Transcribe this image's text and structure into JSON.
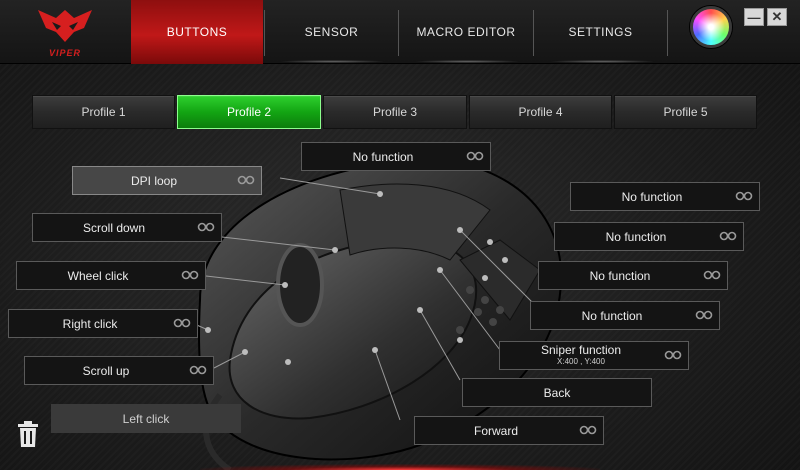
{
  "app": {
    "logo_text": "VIPER",
    "colors": {
      "accent_red": "#c01818",
      "active_green": "#13a513",
      "panel": "#141414"
    }
  },
  "nav": {
    "tabs": [
      {
        "label": "BUTTONS",
        "active": true
      },
      {
        "label": "SENSOR",
        "active": false
      },
      {
        "label": "MACRO EDITOR",
        "active": false
      },
      {
        "label": "SETTINGS",
        "active": false
      }
    ],
    "color_wheel_icon": "rgb-color-wheel-icon",
    "minimize_icon": "minimize-icon",
    "close_icon": "close-icon"
  },
  "profiles": [
    {
      "label": "Profile 1",
      "active": false
    },
    {
      "label": "Profile 2",
      "active": true
    },
    {
      "label": "Profile 3",
      "active": false
    },
    {
      "label": "Profile 4",
      "active": false
    },
    {
      "label": "Profile 5",
      "active": false
    }
  ],
  "buttons": {
    "top_center": {
      "label": "No function"
    },
    "dpi_loop": {
      "label": "DPI loop"
    },
    "scroll_down": {
      "label": "Scroll down"
    },
    "wheel_click": {
      "label": "Wheel click"
    },
    "right_click": {
      "label": "Right click"
    },
    "scroll_up": {
      "label": "Scroll up"
    },
    "left_click": {
      "label": "Left click"
    },
    "side_1": {
      "label": "No function"
    },
    "side_2": {
      "label": "No function"
    },
    "side_3": {
      "label": "No function"
    },
    "side_4": {
      "label": "No function"
    },
    "sniper": {
      "label": "Sniper function",
      "sub": "X:400 , Y:400"
    },
    "back": {
      "label": "Back"
    },
    "forward": {
      "label": "Forward"
    }
  },
  "footer": {
    "trash_icon": "trash-icon"
  }
}
